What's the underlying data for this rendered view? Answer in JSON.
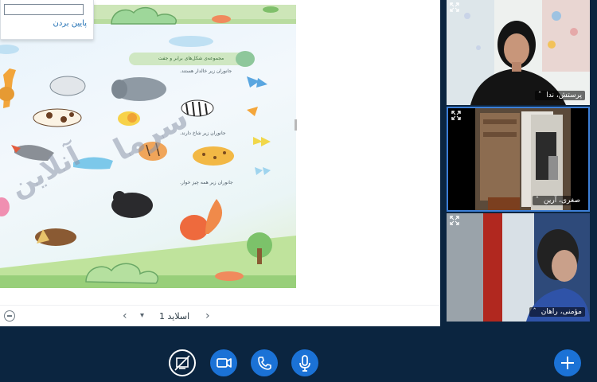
{
  "presentation": {
    "dropdown_option": "پایین بردن",
    "slide": {
      "title_text": "مجموعه‌ی شکل‌های برابر و جفت",
      "line1": "جانوران زیر خالدار هستند.",
      "line2": "جانوران زیر شاخ دارند.",
      "line3": "جانوران زیر همه چیز خوار.",
      "watermark_main": "سرما",
      "watermark_sub": "آنلاین"
    },
    "toolbar": {
      "slide_label": "اسلاید 1",
      "prev_icon": "chevron-left-icon",
      "next_icon": "chevron-right-icon",
      "zoom_icon": "zoom-out-icon"
    }
  },
  "participants": [
    {
      "name": "پرستش، ندا"
    },
    {
      "name": "صغری، آرین"
    },
    {
      "name": "مؤمنی، راهان"
    }
  ],
  "controls": {
    "screen_share": "screen-share-off-icon",
    "video": "video-camera-icon",
    "phone": "phone-icon",
    "mic": "microphone-icon",
    "add": "plus-icon"
  },
  "colors": {
    "background": "#0b2540",
    "accent": "#1b72d6"
  }
}
